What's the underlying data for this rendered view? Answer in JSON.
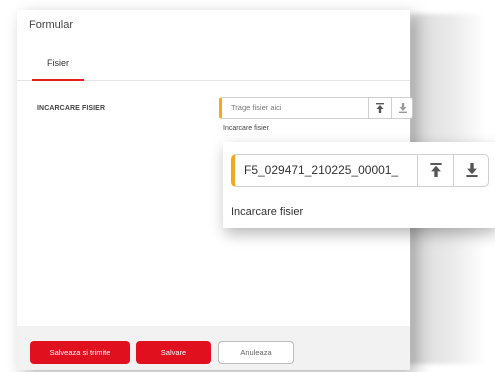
{
  "form": {
    "title": "Formular",
    "tabs": [
      {
        "label": "Fisier"
      }
    ],
    "field_label": "INCARCARE FISIER",
    "upload": {
      "placeholder": "Trage fisier aici",
      "helper": "Incarcare fisier",
      "upload_icon": "upload-icon",
      "download_icon": "download-icon"
    },
    "zoom": {
      "value": "F5_029471_210225_00001_",
      "helper": "Incarcare fisier"
    },
    "footer": {
      "save_submit": "Salveaza si trimite",
      "save": "Salvare",
      "cancel": "Anuleaza"
    },
    "colors": {
      "accent": "#e0101f",
      "input_accent": "#f5a623",
      "footer_bg": "#f2f2f2"
    }
  }
}
